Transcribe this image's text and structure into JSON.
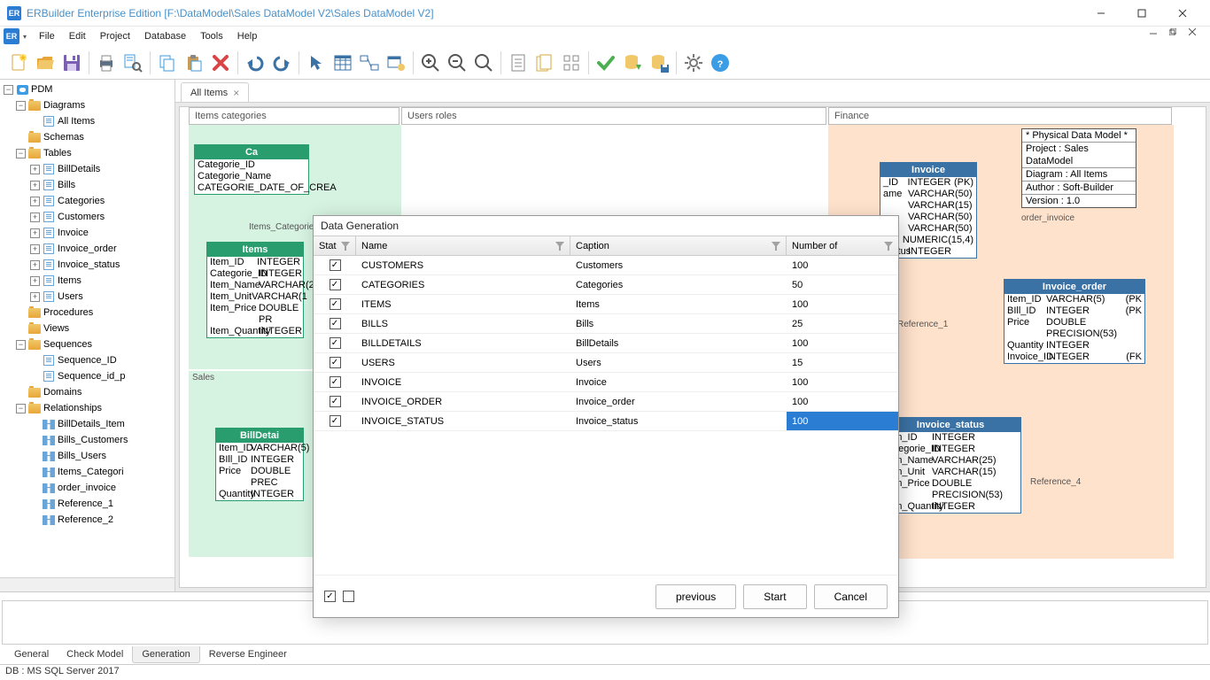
{
  "window": {
    "title": "ERBuilder Enterprise Edition [F:\\DataModel\\Sales DataModel V2\\Sales DataModel V2]"
  },
  "menubar": [
    "File",
    "Edit",
    "Project",
    "Database",
    "Tools",
    "Help"
  ],
  "tab": {
    "label": "All Items"
  },
  "tree": {
    "root": "PDM",
    "diagrams": "Diagrams",
    "all_items": "All Items",
    "schemas": "Schemas",
    "tables": "Tables",
    "table_items": [
      "BillDetails",
      "Bills",
      "Categories",
      "Customers",
      "Invoice",
      "Invoice_order",
      "Invoice_status",
      "Items",
      "Users"
    ],
    "procedures": "Procedures",
    "views": "Views",
    "sequences": "Sequences",
    "sequence_items": [
      "Sequence_ID",
      "Sequence_id_p"
    ],
    "domains": "Domains",
    "relationships": "Relationships",
    "rel_items": [
      "BillDetails_Item",
      "Bills_Customers",
      "Bills_Users",
      "Items_Categori",
      "order_invoice",
      "Reference_1",
      "Reference_2"
    ]
  },
  "canvas": {
    "bands": {
      "items_categories": "Items categories",
      "users_roles": "Users roles",
      "finance": "Finance"
    },
    "labels": {
      "sales": "Sales",
      "items_categorie": "Items_Categorie",
      "reference_1": "Reference_1",
      "reference_4": "Reference_4",
      "order_invoice": "order_invoice"
    },
    "entities": {
      "categories": {
        "title": "Ca",
        "rows": [
          [
            "Categorie_ID",
            "",
            ""
          ],
          [
            "Categorie_Name",
            "",
            ""
          ],
          [
            "CATEGORIE_DATE_OF_CREA",
            "",
            ""
          ]
        ]
      },
      "items": {
        "title": "Items",
        "rows": [
          [
            "Item_ID",
            "INTEGER",
            ""
          ],
          [
            "Categorie_ID",
            "INTEGER",
            ""
          ],
          [
            "Item_Name",
            "VARCHAR(2",
            ""
          ],
          [
            "Item_Unit",
            "VARCHAR(1",
            ""
          ],
          [
            "Item_Price",
            "DOUBLE PR",
            ""
          ],
          [
            "Item_Quantity",
            "INTEGER",
            ""
          ]
        ]
      },
      "billdetails": {
        "title": "BillDetai",
        "rows": [
          [
            "Item_ID",
            "VARCHAR(5)",
            ""
          ],
          [
            "BIll_ID",
            "INTEGER",
            ""
          ],
          [
            "Price",
            "DOUBLE PREC",
            ""
          ],
          [
            "Quantity",
            "INTEGER",
            ""
          ]
        ]
      },
      "invoice": {
        "title": "Invoice",
        "rows": [
          [
            "_ID",
            "INTEGER",
            "(PK)"
          ],
          [
            "ame",
            "VARCHAR(50)",
            ""
          ],
          [
            "",
            "VARCHAR(15)",
            ""
          ],
          [
            "",
            "VARCHAR(50)",
            ""
          ],
          [
            "s",
            "VARCHAR(50)",
            ""
          ],
          [
            "gin",
            "NUMERIC(15,4)",
            ""
          ],
          [
            "Status",
            "INTEGER",
            ""
          ]
        ]
      },
      "invoice_order": {
        "title": "Invoice_order",
        "rows": [
          [
            "Item_ID",
            "VARCHAR(5)",
            "(PK"
          ],
          [
            "BIll_ID",
            "INTEGER",
            "(PK"
          ],
          [
            "Price",
            "DOUBLE PRECISION(53)",
            ""
          ],
          [
            "Quantity",
            "INTEGER",
            ""
          ],
          [
            "Invoice_ID",
            "INTEGER",
            "(FK"
          ]
        ]
      },
      "invoice_status": {
        "title": "Invoice_status",
        "rows": [
          [
            "Item_ID",
            "INTEGER",
            ""
          ],
          [
            "Categorie_ID",
            "INTEGER",
            ""
          ],
          [
            "Item_Name",
            "VARCHAR(25)",
            ""
          ],
          [
            "Item_Unit",
            "VARCHAR(15)",
            ""
          ],
          [
            "Item_Price",
            "DOUBLE PRECISION(53)",
            ""
          ],
          [
            "Item_Quantity",
            "INTEGER",
            ""
          ]
        ]
      }
    },
    "info_box": [
      "* Physical Data Model *",
      "Project : Sales DataModel",
      "Diagram : All Items",
      "Author : Soft-Builder",
      "Version : 1.0"
    ]
  },
  "dialog": {
    "title": "Data Generation",
    "headers": {
      "stat": "Stat",
      "name": "Name",
      "caption": "Caption",
      "number": "Number of"
    },
    "rows": [
      {
        "name": "CUSTOMERS",
        "caption": "Customers",
        "number": "100"
      },
      {
        "name": "CATEGORIES",
        "caption": "Categories",
        "number": "50"
      },
      {
        "name": "ITEMS",
        "caption": "Items",
        "number": "100"
      },
      {
        "name": "BILLS",
        "caption": "Bills",
        "number": "25"
      },
      {
        "name": "BILLDETAILS",
        "caption": "BillDetails",
        "number": "100"
      },
      {
        "name": "USERS",
        "caption": "Users",
        "number": "15"
      },
      {
        "name": "INVOICE",
        "caption": "Invoice",
        "number": "100"
      },
      {
        "name": "INVOICE_ORDER",
        "caption": "Invoice_order",
        "number": "100"
      },
      {
        "name": "INVOICE_STATUS",
        "caption": "Invoice_status",
        "number": "100"
      }
    ],
    "buttons": {
      "previous": "previous",
      "start": "Start",
      "cancel": "Cancel"
    }
  },
  "bottom_tabs": {
    "general": "General",
    "check_model": "Check Model",
    "generation": "Generation",
    "reverse": "Reverse Engineer"
  },
  "statusbar": {
    "db": "DB : MS SQL Server 2017"
  }
}
